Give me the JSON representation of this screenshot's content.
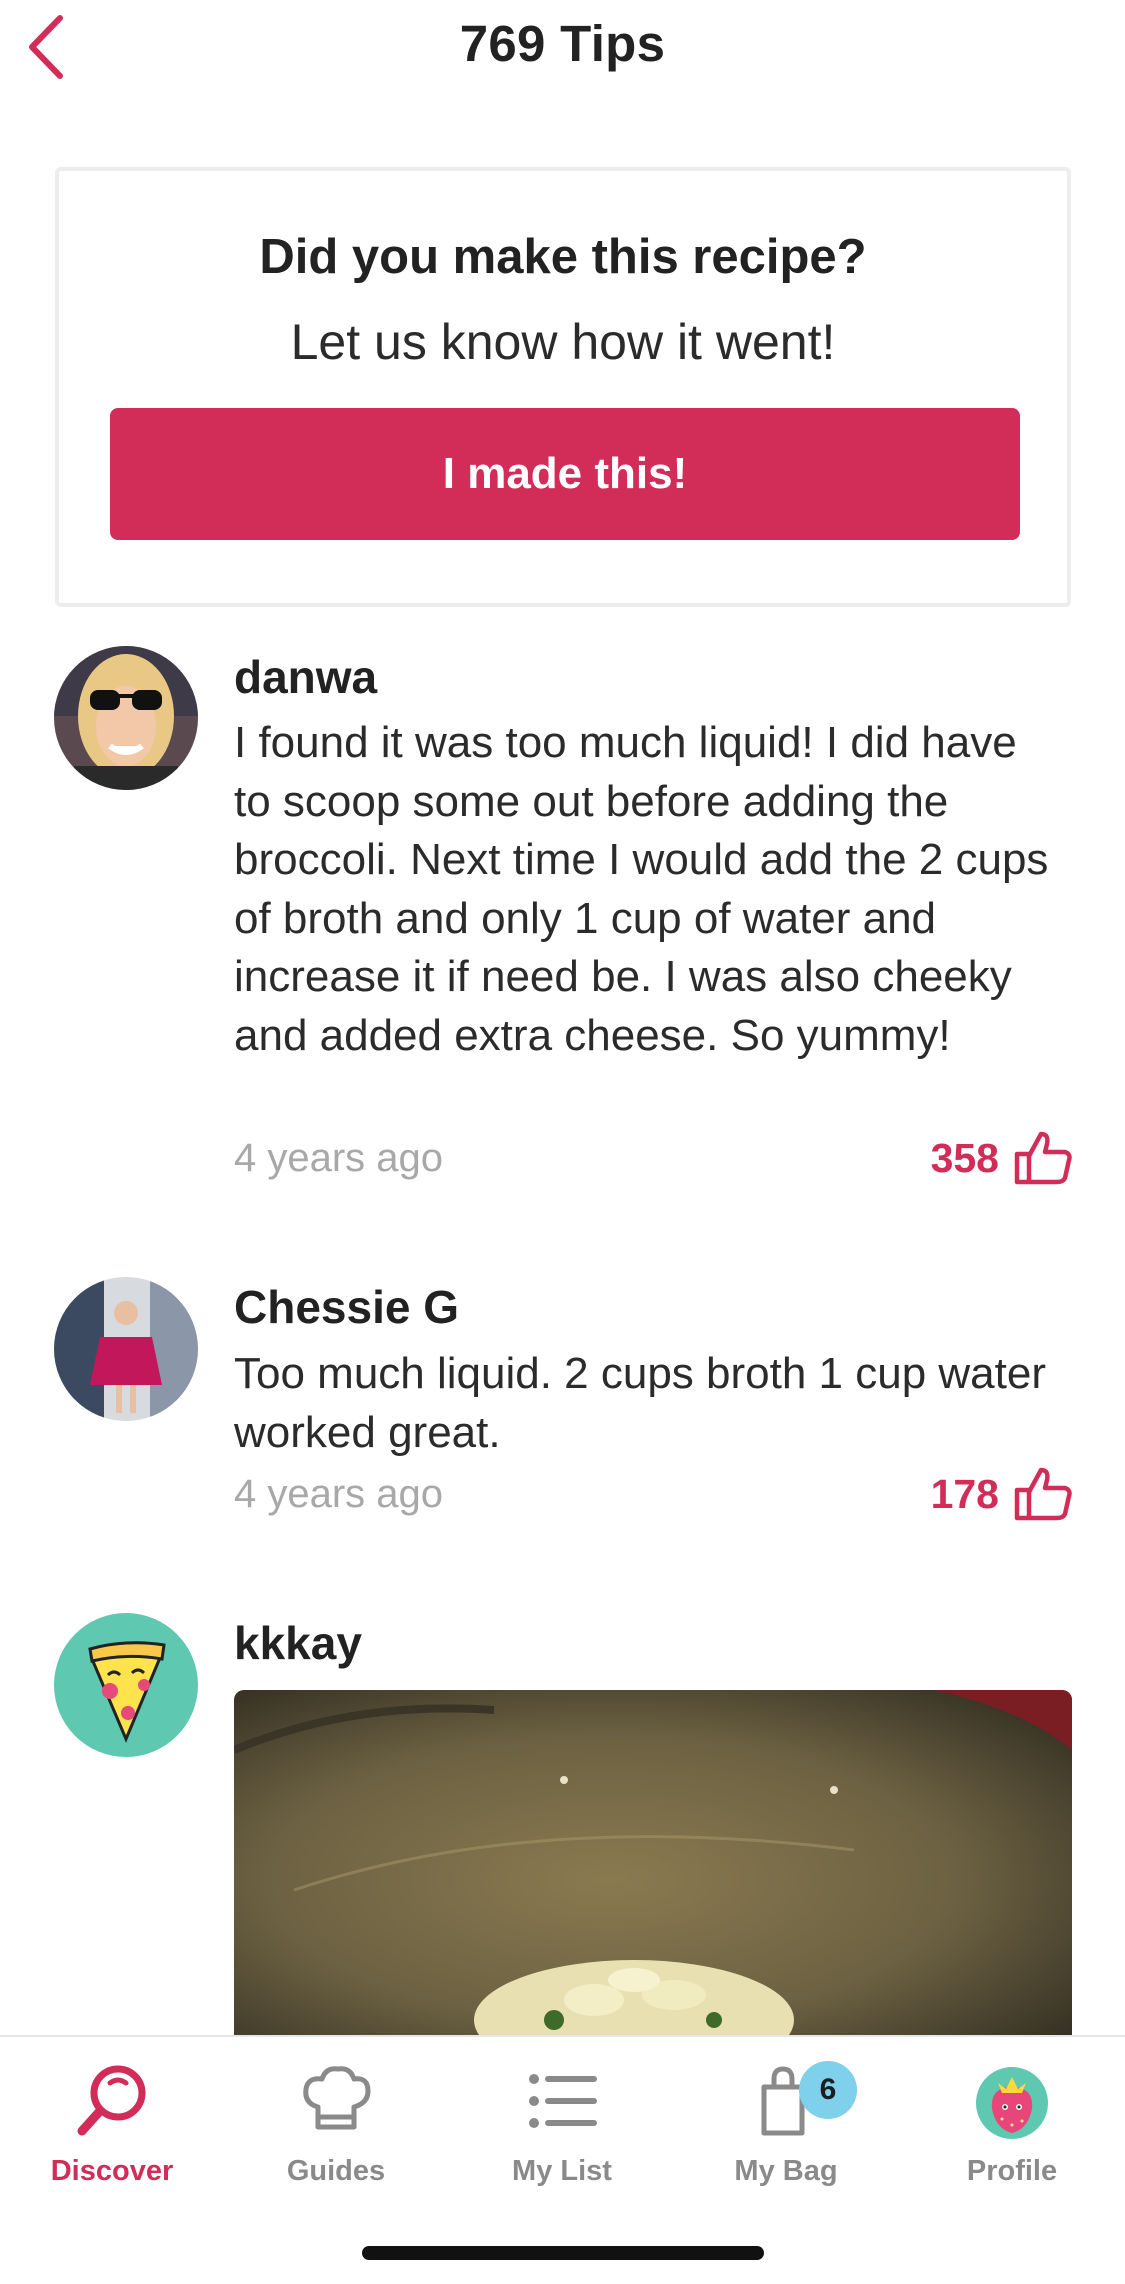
{
  "header": {
    "title": "769 Tips",
    "back_icon": "chevron-left-icon",
    "accent_color": "#d22c58"
  },
  "prompt_card": {
    "question": "Did you make this recipe?",
    "subtitle": "Let us know how it went!",
    "button_label": "I made this!",
    "button_color": "#d22c58"
  },
  "tips": [
    {
      "user": "danwa",
      "text": "I found it was too much liquid! I did have to scoop some out before adding the broccoli. Next time I would add the 2 cups of broth and only 1 cup of water and increase it if need be. I was also cheeky and added extra cheese. So yummy!",
      "time": "4 years ago",
      "likes": "358"
    },
    {
      "user": "Chessie G",
      "text": "Too much liquid. 2 cups broth 1 cup water worked great.",
      "time": "4 years ago",
      "likes": "178"
    },
    {
      "user": "kkkay",
      "has_photo": true
    }
  ],
  "tabbar": {
    "tabs": [
      {
        "label": "Discover",
        "icon": "search-icon",
        "active": true
      },
      {
        "label": "Guides",
        "icon": "chef-hat-icon",
        "active": false
      },
      {
        "label": "My List",
        "icon": "list-icon",
        "active": false
      },
      {
        "label": "My Bag",
        "icon": "bag-icon",
        "active": false,
        "badge": "6"
      },
      {
        "label": "Profile",
        "icon": "strawberry-avatar-icon",
        "active": false
      }
    ]
  }
}
